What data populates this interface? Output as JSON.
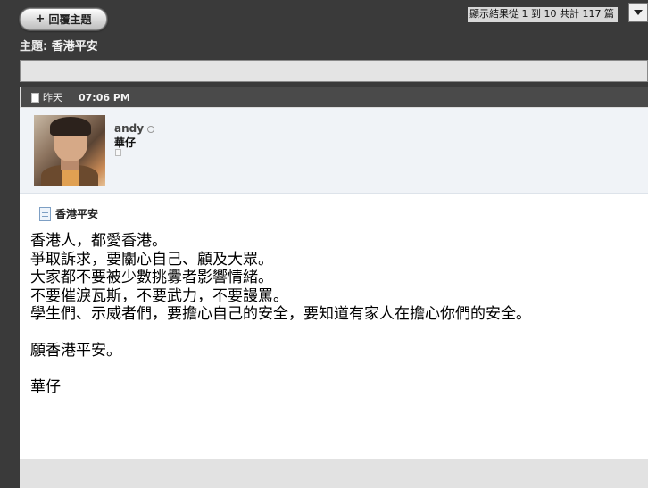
{
  "toolbar": {
    "reply_label": "回覆主題",
    "reply_icon": "plus-icon"
  },
  "pager": {
    "info": "顯示結果從 1 到 10 共計 117 篇"
  },
  "thread": {
    "title_prefix": "主題:",
    "title": "香港平安"
  },
  "post": {
    "date": "昨天",
    "time": "07:06 PM",
    "user": {
      "name": "andy",
      "title": "華仔"
    },
    "title": "香港平安",
    "body": [
      "香港人，都愛香港。",
      "爭取訴求，要關心自己、顧及大眾。",
      "大家都不要被少數挑釁者影響情緒。",
      "不要催淚瓦斯，不要武力，不要謾罵。",
      "學生們、示威者們，要擔心自己的安全，要知道有家人在擔心你們的安全。",
      "",
      "願香港平安。",
      "",
      "華仔"
    ]
  }
}
